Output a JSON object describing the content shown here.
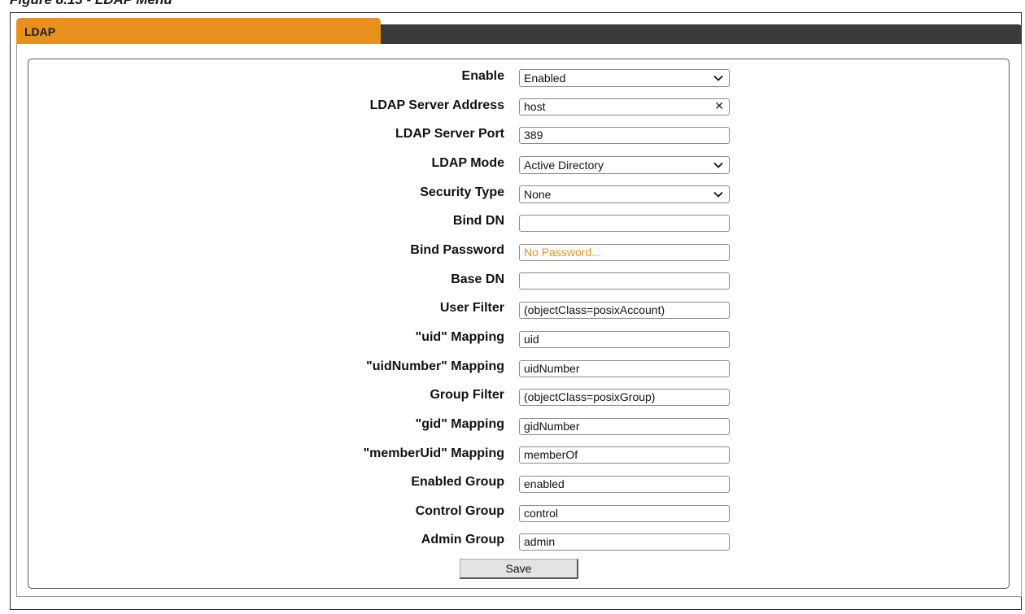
{
  "caption": "Figure 8.13 - LDAP Menu",
  "tab": {
    "label": "LDAP"
  },
  "form": {
    "fields": [
      {
        "label": "Enable",
        "value": "Enabled",
        "kind": "select"
      },
      {
        "label": "LDAP Server Address",
        "value": "host",
        "kind": "text-clear"
      },
      {
        "label": "LDAP Server Port",
        "value": "389",
        "kind": "text"
      },
      {
        "label": "LDAP Mode",
        "value": "Active Directory",
        "kind": "select"
      },
      {
        "label": "Security Type",
        "value": "None",
        "kind": "select"
      },
      {
        "label": "Bind DN",
        "value": "",
        "kind": "text"
      },
      {
        "label": "Bind Password",
        "value": "",
        "placeholder": "No Password...",
        "kind": "password"
      },
      {
        "label": "Base DN",
        "value": "",
        "kind": "text"
      },
      {
        "label": "User Filter",
        "value": "(objectClass=posixAccount)",
        "kind": "text"
      },
      {
        "label": "\"uid\" Mapping",
        "value": "uid",
        "kind": "text"
      },
      {
        "label": "\"uidNumber\" Mapping",
        "value": "uidNumber",
        "kind": "text"
      },
      {
        "label": "Group Filter",
        "value": "(objectClass=posixGroup)",
        "kind": "text"
      },
      {
        "label": "\"gid\" Mapping",
        "value": "gidNumber",
        "kind": "text"
      },
      {
        "label": "\"memberUid\" Mapping",
        "value": "memberOf",
        "kind": "text"
      },
      {
        "label": "Enabled Group",
        "value": "enabled",
        "kind": "text"
      },
      {
        "label": "Control Group",
        "value": "control",
        "kind": "text"
      },
      {
        "label": "Admin Group",
        "value": "admin",
        "kind": "text"
      }
    ],
    "save_label": "Save"
  },
  "colors": {
    "tab_active": "#e8901e",
    "tab_bar": "#3a3a3a",
    "placeholder": "#e0962a"
  }
}
